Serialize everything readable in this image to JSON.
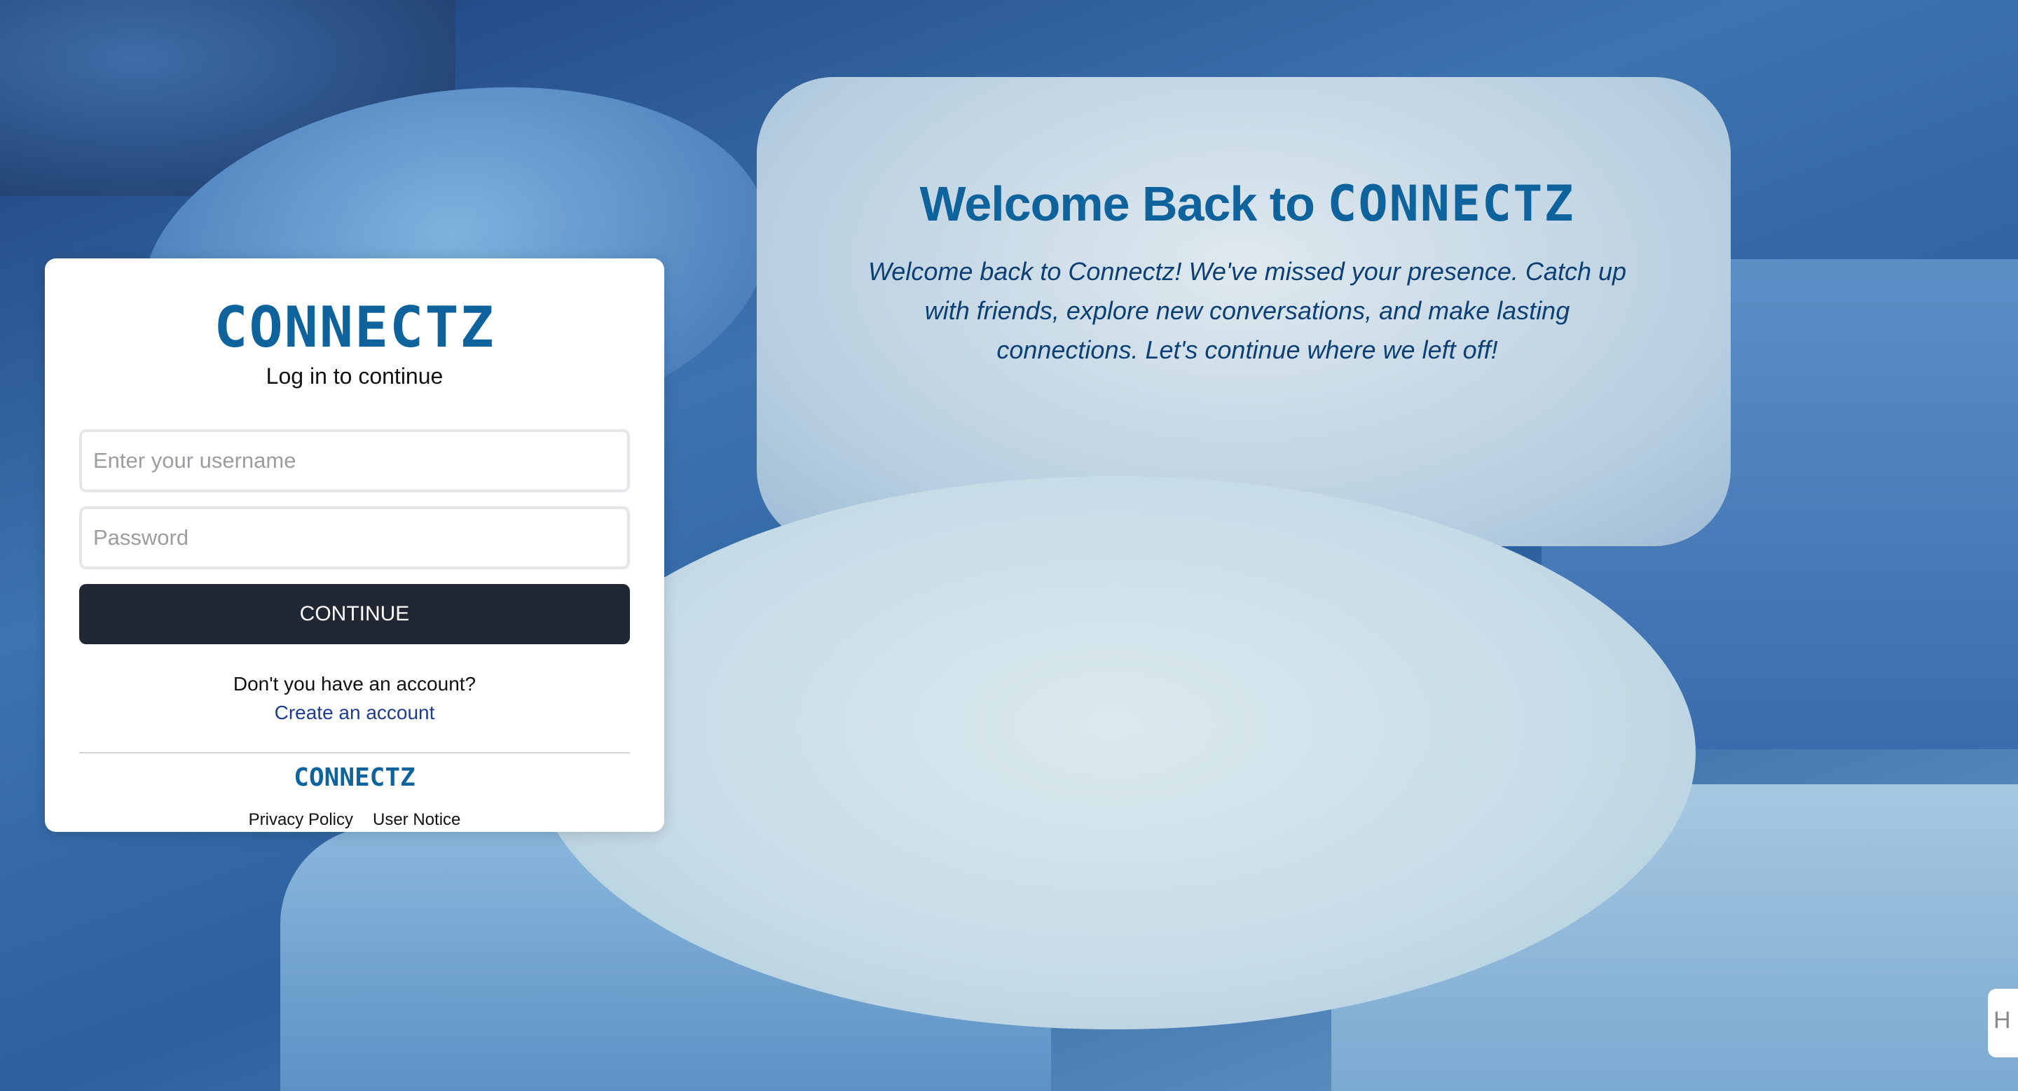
{
  "hero": {
    "title_prefix": "Welcome Back to",
    "title_brand": "CONNECTZ",
    "text": "Welcome back to Connectz! We've missed your presence. Catch up with friends, explore new conversations, and make lasting connections. Let's continue where we left off!"
  },
  "login": {
    "logo": "CONNECTZ",
    "subtitle": "Log in to continue",
    "username_placeholder": "Enter your username",
    "password_placeholder": "Password",
    "continue_label": "CONTINUE",
    "no_account": "Don't you have an account?",
    "create_account": "Create an account",
    "footer_logo": "CONNECTZ",
    "privacy": "Privacy Policy",
    "user_notice": "User Notice"
  },
  "widget": {
    "icon": "H"
  }
}
